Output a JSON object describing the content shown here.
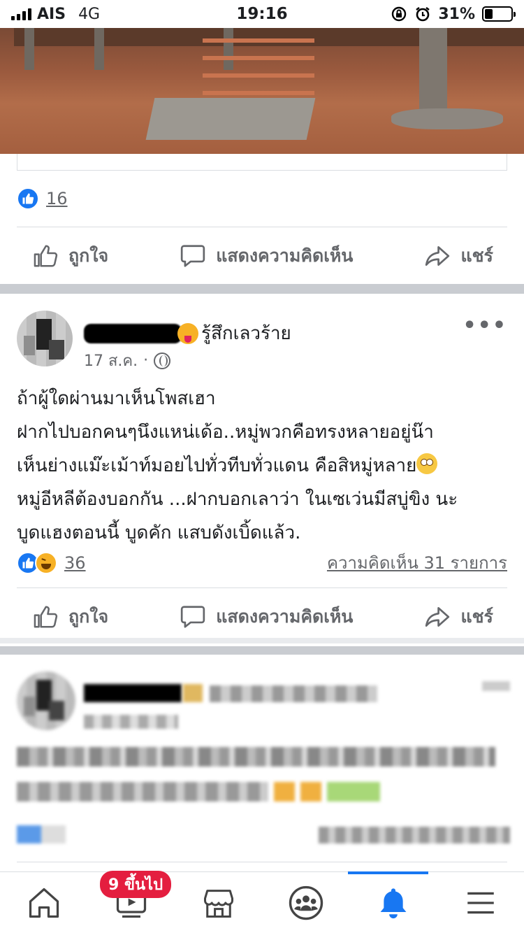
{
  "status_bar": {
    "carrier": "AIS",
    "network": "4G",
    "time": "19:16",
    "battery": "31%",
    "battery_level": 0.31
  },
  "previous_post": {
    "reaction_count": "16",
    "actions": {
      "like": "ถูกใจ",
      "comment": "แสดงความคิดเห็น",
      "share": "แชร์"
    }
  },
  "post": {
    "feeling": "รู้สึกเลวร้าย",
    "date": "17 ส.ค.",
    "dot": "·",
    "text_lines": [
      "ถ้าผู้ใดผ่านมาเห็นโพสเฮา",
      "ฝากไปบอกคนๆนึงแหน่เด้อ..หมู่พวกคือทรงหลายอยู่น๊า",
      "เห็นย่างแม๊ะเม้าท์มอยไปทั่วทีบทั่วแดน คือสิหมู่หลาย",
      "หมู่อีหลีต้องบอกกัน ...ฝากบอกเลาว่า ในเซเว่นมีสบู่ขิง นะ",
      "บูดแฮงตอนนี้ บูดคัก แสบดังเบิ้ดแล้ว."
    ],
    "reaction_count": "36",
    "comments_link": "ความคิดเห็น 31 รายการ",
    "actions": {
      "like": "ถูกใจ",
      "comment": "แสดงความคิดเห็น",
      "share": "แชร์"
    }
  },
  "tab_bar": {
    "video_badge": "9 ขึ้นไป",
    "tabs": [
      "home-icon",
      "video-icon",
      "marketplace-icon",
      "groups-icon",
      "notifications-icon",
      "menu-icon"
    ],
    "active_tab": "notifications-icon"
  },
  "colors": {
    "accent": "#1877f2",
    "badge": "#e41e3f",
    "secondary_text": "#65676b",
    "separator": "#c9ccd1"
  }
}
